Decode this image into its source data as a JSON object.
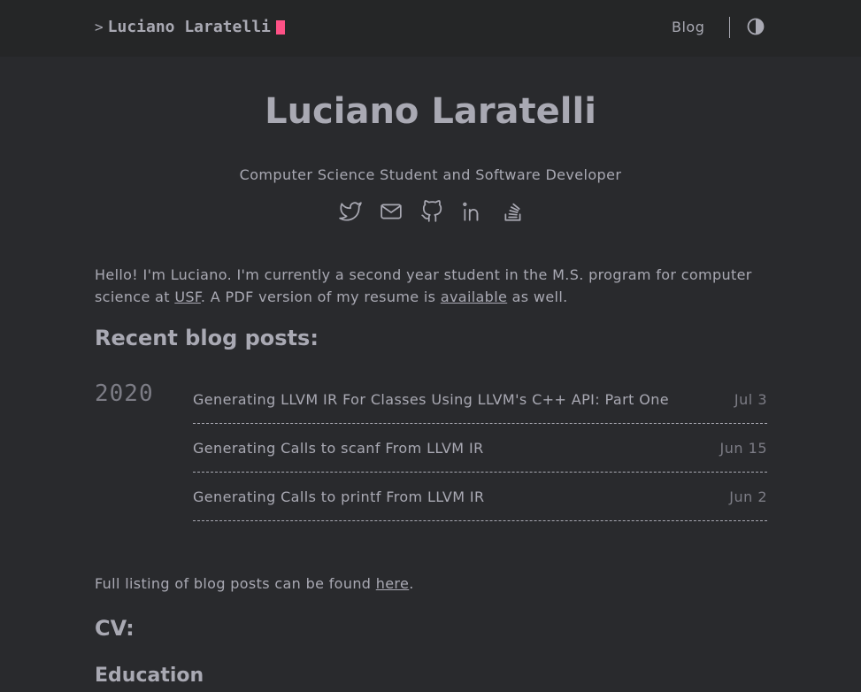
{
  "header": {
    "prompt": ">",
    "logo_text": "Luciano Laratelli",
    "nav": {
      "blog_label": "Blog"
    },
    "accent_color": "#fe5186"
  },
  "hero": {
    "title": "Luciano Laratelli",
    "subtitle": "Computer Science Student and Software Developer",
    "social_icons": [
      "twitter-icon",
      "mail-icon",
      "github-icon",
      "linkedin-icon",
      "stackoverflow-icon"
    ]
  },
  "intro": {
    "text_1": "Hello! I'm Luciano. I'm currently a second year student in the M.S. program for computer science at ",
    "link_usf": "USF",
    "text_2": ". A PDF version of my resume is ",
    "link_available": "available",
    "text_3": " as well."
  },
  "recent": {
    "heading": "Recent blog posts:",
    "year": "2020",
    "posts": [
      {
        "title": "Generating LLVM IR For Classes Using LLVM's C++ API: Part One",
        "date": "Jul 3"
      },
      {
        "title": "Generating Calls to scanf From LLVM IR",
        "date": "Jun 15"
      },
      {
        "title": "Generating Calls to printf From LLVM IR",
        "date": "Jun 2"
      }
    ]
  },
  "listing": {
    "text_1": "Full listing of blog posts can be found ",
    "link_here": "here",
    "text_2": "."
  },
  "cv": {
    "heading": "CV:",
    "education_heading": "Education"
  }
}
